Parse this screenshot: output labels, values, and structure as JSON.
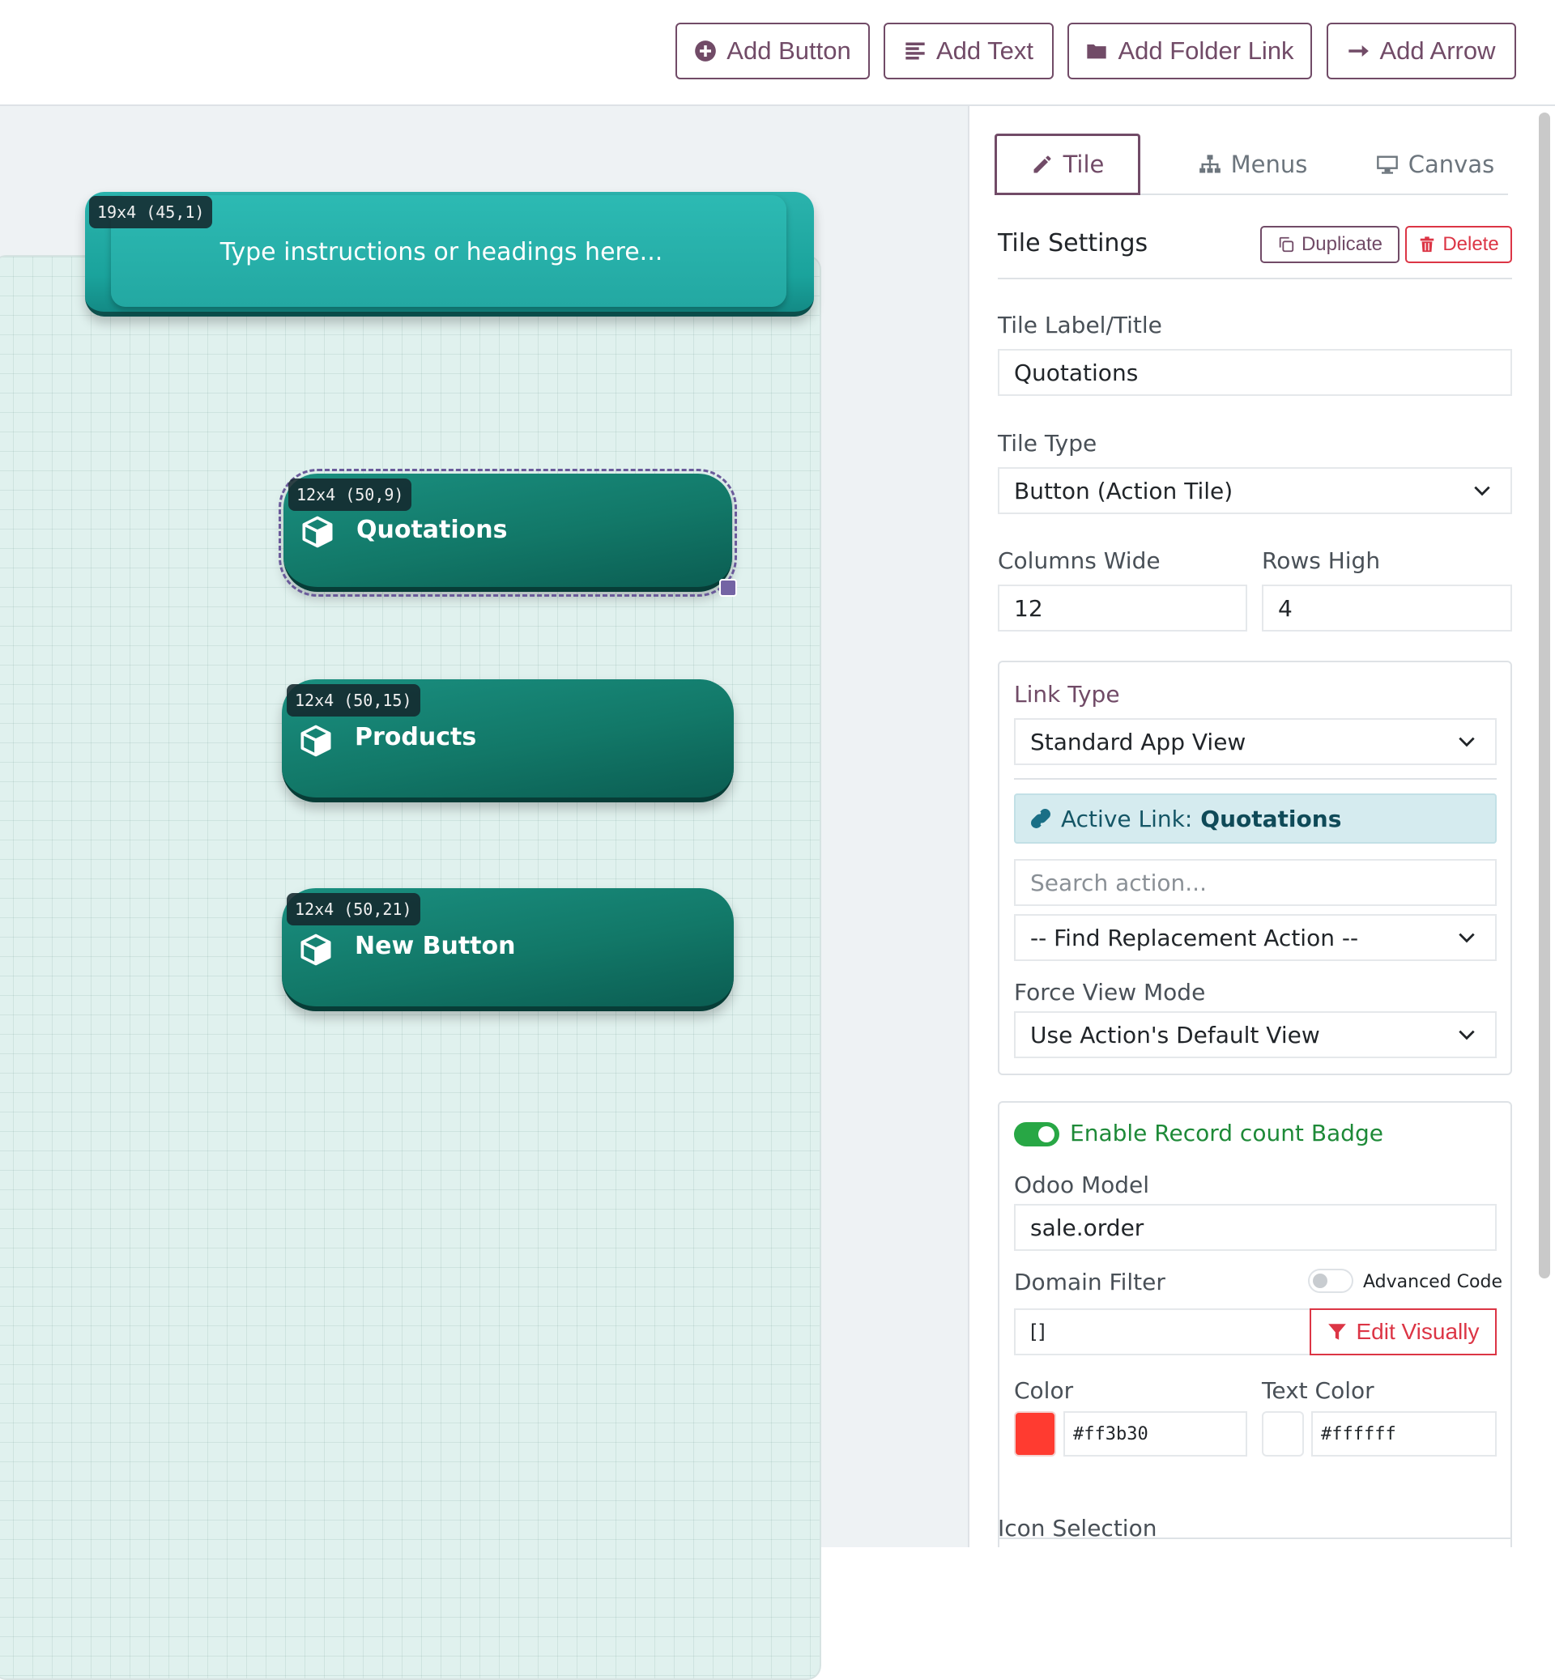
{
  "toolbar": {
    "add_button": "Add Button",
    "add_text": "Add Text",
    "add_folder_link": "Add Folder Link",
    "add_arrow": "Add Arrow"
  },
  "canvas": {
    "tiles": [
      {
        "badge": "19x4 (45,1)",
        "label": "Type instructions or headings here..."
      },
      {
        "badge": "12x4 (50,9)",
        "label": "Quotations"
      },
      {
        "badge": "12x4 (50,15)",
        "label": "Products"
      },
      {
        "badge": "12x4 (50,21)",
        "label": "New Button"
      }
    ]
  },
  "panel": {
    "tabs": [
      {
        "label": "Tile",
        "icon": "pencil-icon",
        "active": true
      },
      {
        "label": "Menus",
        "icon": "sitemap-icon",
        "active": false
      },
      {
        "label": "Canvas",
        "icon": "desktop-icon",
        "active": false
      }
    ],
    "section_title": "Tile Settings",
    "duplicate_label": "Duplicate",
    "delete_label": "Delete",
    "tile_label_title": "Tile Label/Title",
    "tile_label_value": "Quotations",
    "tile_type_label": "Tile Type",
    "tile_type_value": "Button (Action Tile)",
    "columns_wide_label": "Columns Wide",
    "columns_wide_value": "12",
    "rows_high_label": "Rows High",
    "rows_high_value": "4",
    "link_type_label": "Link Type",
    "link_type_value": "Standard App View",
    "active_link_prefix": "Active Link:",
    "active_link_value": "Quotations",
    "search_action_placeholder": "Search action...",
    "find_replacement_value": "-- Find Replacement Action --",
    "force_view_label": "Force View Mode",
    "force_view_value": "Use Action's Default View",
    "badge_toggle_label": "Enable Record count Badge",
    "odoo_model_label": "Odoo Model",
    "odoo_model_value": "sale.order",
    "domain_filter_label": "Domain Filter",
    "advanced_code_label": "Advanced Code",
    "domain_value": "[]",
    "edit_visually_label": "Edit Visually",
    "color_label": "Color",
    "color_value": "#ff3b30",
    "text_color_label": "Text Color",
    "text_color_value": "#ffffff",
    "icon_selection_label": "Icon Selection"
  },
  "colors": {
    "brand": "#714b67",
    "tile_teal": "#127868",
    "text_tile_teal": "#1fa9a2",
    "success": "#28a745",
    "danger": "#dc3545",
    "tile_color": "#ff3b30",
    "tile_text_color": "#ffffff"
  }
}
